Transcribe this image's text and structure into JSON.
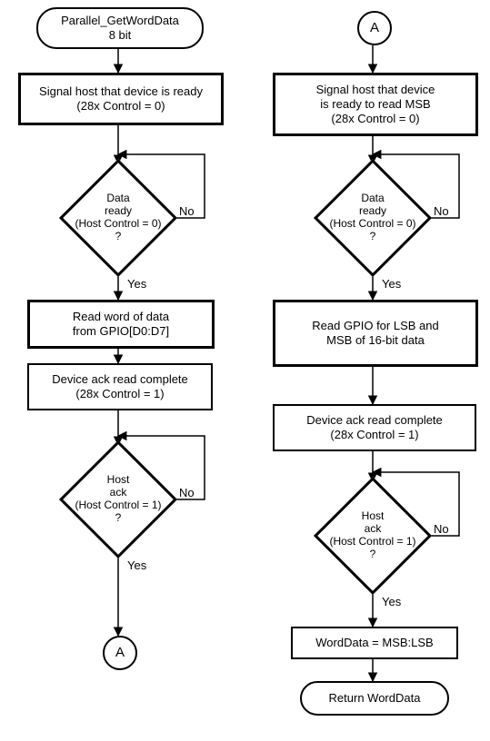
{
  "left": {
    "start": {
      "l1": "Parallel_GetWordData",
      "l2": "8 bit"
    },
    "signal": {
      "l1": "Signal host that device is ready",
      "l2": "(28x Control = 0)"
    },
    "d_ready": {
      "l1": "Data",
      "l2": "ready",
      "l3": "(Host Control = 0)",
      "l4": "?"
    },
    "read": {
      "l1": "Read word of data",
      "l2": "from GPIO[D0:D7]"
    },
    "ack": {
      "l1": "Device ack read complete",
      "l2": "(28x Control = 1)"
    },
    "d_hack": {
      "l1": "Host",
      "l2": "ack",
      "l3": "(Host Control = 1)",
      "l4": "?"
    },
    "conn": "A"
  },
  "right": {
    "conn": "A",
    "signal": {
      "l1": "Signal host that device",
      "l2": "is ready to read MSB",
      "l3": "(28x Control = 0)"
    },
    "d_ready": {
      "l1": "Data",
      "l2": "ready",
      "l3": "(Host Control = 0)",
      "l4": "?"
    },
    "read": {
      "l1": "Read GPIO for LSB and",
      "l2": "MSB of 16-bit data"
    },
    "ack": {
      "l1": "Device ack read complete",
      "l2": "(28x Control = 1)"
    },
    "d_hack": {
      "l1": "Host",
      "l2": "ack",
      "l3": "(Host Control = 1)",
      "l4": "?"
    },
    "word": "WordData = MSB:LSB",
    "ret": "Return WordData"
  },
  "labels": {
    "yes": "Yes",
    "no": "No"
  }
}
